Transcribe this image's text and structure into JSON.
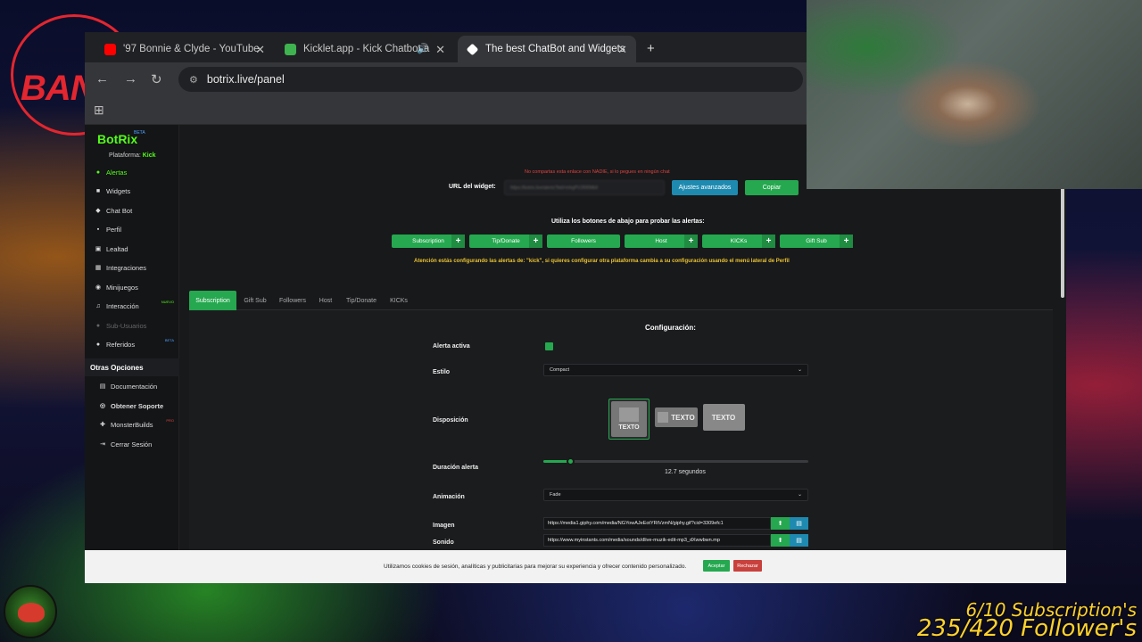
{
  "overlay": {
    "bang_text": "BANG",
    "subscriptions": "6/10 Subscription's",
    "followers": "235/420 Follower's"
  },
  "browser": {
    "tabs": [
      {
        "title": "'97 Bonnie & Clyde - YouTube",
        "active": false
      },
      {
        "title": "Kicklet.app - Kick Chatbot a",
        "active": false
      },
      {
        "title": "The best ChatBot and Widgets",
        "active": true
      }
    ],
    "url": "botrix.live/panel"
  },
  "sidebar": {
    "logo": "BotRix",
    "beta": "BETA",
    "platform_label": "Plataforma:",
    "platform_value": "Kick",
    "items": [
      {
        "label": "Alertas",
        "icon": "bell-icon",
        "active": true
      },
      {
        "label": "Widgets",
        "icon": "grid-icon"
      },
      {
        "label": "Chat Bot",
        "icon": "robot-icon"
      },
      {
        "label": "Perfil",
        "icon": "user-icon"
      },
      {
        "label": "Lealtad",
        "icon": "bag-icon"
      },
      {
        "label": "Integraciones",
        "icon": "plug-icon"
      },
      {
        "label": "Minijuegos",
        "icon": "gamepad-icon"
      },
      {
        "label": "Interacción",
        "icon": "music-icon",
        "badge": "NUEVO"
      },
      {
        "label": "Sub-Usuarios",
        "icon": "users-icon",
        "disabled": true
      },
      {
        "label": "Referidos",
        "icon": "users-icon",
        "badge": "BETA"
      }
    ],
    "other_header": "Otras Opciones",
    "other_items": [
      {
        "label": "Documentación",
        "icon": "book-icon"
      },
      {
        "label": "Obtener Soporte",
        "icon": "support-icon"
      },
      {
        "label": "MonsterBuilds",
        "icon": "tool-icon",
        "badge": "PRO"
      },
      {
        "label": "Cerrar Sesión",
        "icon": "logout-icon"
      }
    ]
  },
  "widget": {
    "warning": "No compartas esta enlace con NADIE, si lo pegues en ningún chat",
    "url_label": "URL del widget:",
    "url_value": "https://botrix.live/alerts?bid=mhgPV2RRMbIl",
    "advanced_button": "Ajustes avanzados",
    "copy_button": "Copiar"
  },
  "test": {
    "hint": "Utiliza los botones de abajo para probar las alertas:",
    "buttons": [
      "Subscription",
      "Tip/Donate",
      "Followers",
      "Host",
      "KICKs",
      "Gift Sub"
    ],
    "attention": "Atención estás configurando las alertas de: \"kick\", si quieres configurar otra plataforma cambia a su configuración usando el menú lateral de Perfil"
  },
  "alert_tabs": [
    "Subscription",
    "Gift Sub",
    "Followers",
    "Host",
    "Tip/Donate",
    "KICKs"
  ],
  "config": {
    "title": "Configuración:",
    "active_label": "Alerta activa",
    "active_value": true,
    "style_label": "Estilo",
    "style_value": "Compact",
    "layout_label": "Disposición",
    "layout_options": [
      "TEXTO",
      "TEXTO",
      "TEXTO"
    ],
    "duration_label": "Duración alerta",
    "duration_value": "12.7",
    "duration_unit": "segundos",
    "duration_fraction": 0.1,
    "animation_label": "Animación",
    "animation_value": "Fade",
    "image_label": "Imagen",
    "image_value": "https://media1.giphy.com/media/NGYowAJeEotYRtVzmN/giphy.gif?cid=3309efc1",
    "sound_label": "Sonido",
    "sound_value": "https://www.myinstants.com/media/sounds/dlive-muzik-edit-mp3_dXwwbwn.mp"
  },
  "cookie": {
    "text": "Utilizamos cookies de sesión, analíticas y publicitarias para mejorar su experiencia y ofrecer contenido personalizado.",
    "accept": "Aceptar",
    "reject": "Rechazar"
  },
  "colors": {
    "accent": "#25a84f",
    "kick": "#53fc18",
    "info": "#1e8ab0",
    "danger": "#c9413d",
    "warning": "#e9c230"
  }
}
